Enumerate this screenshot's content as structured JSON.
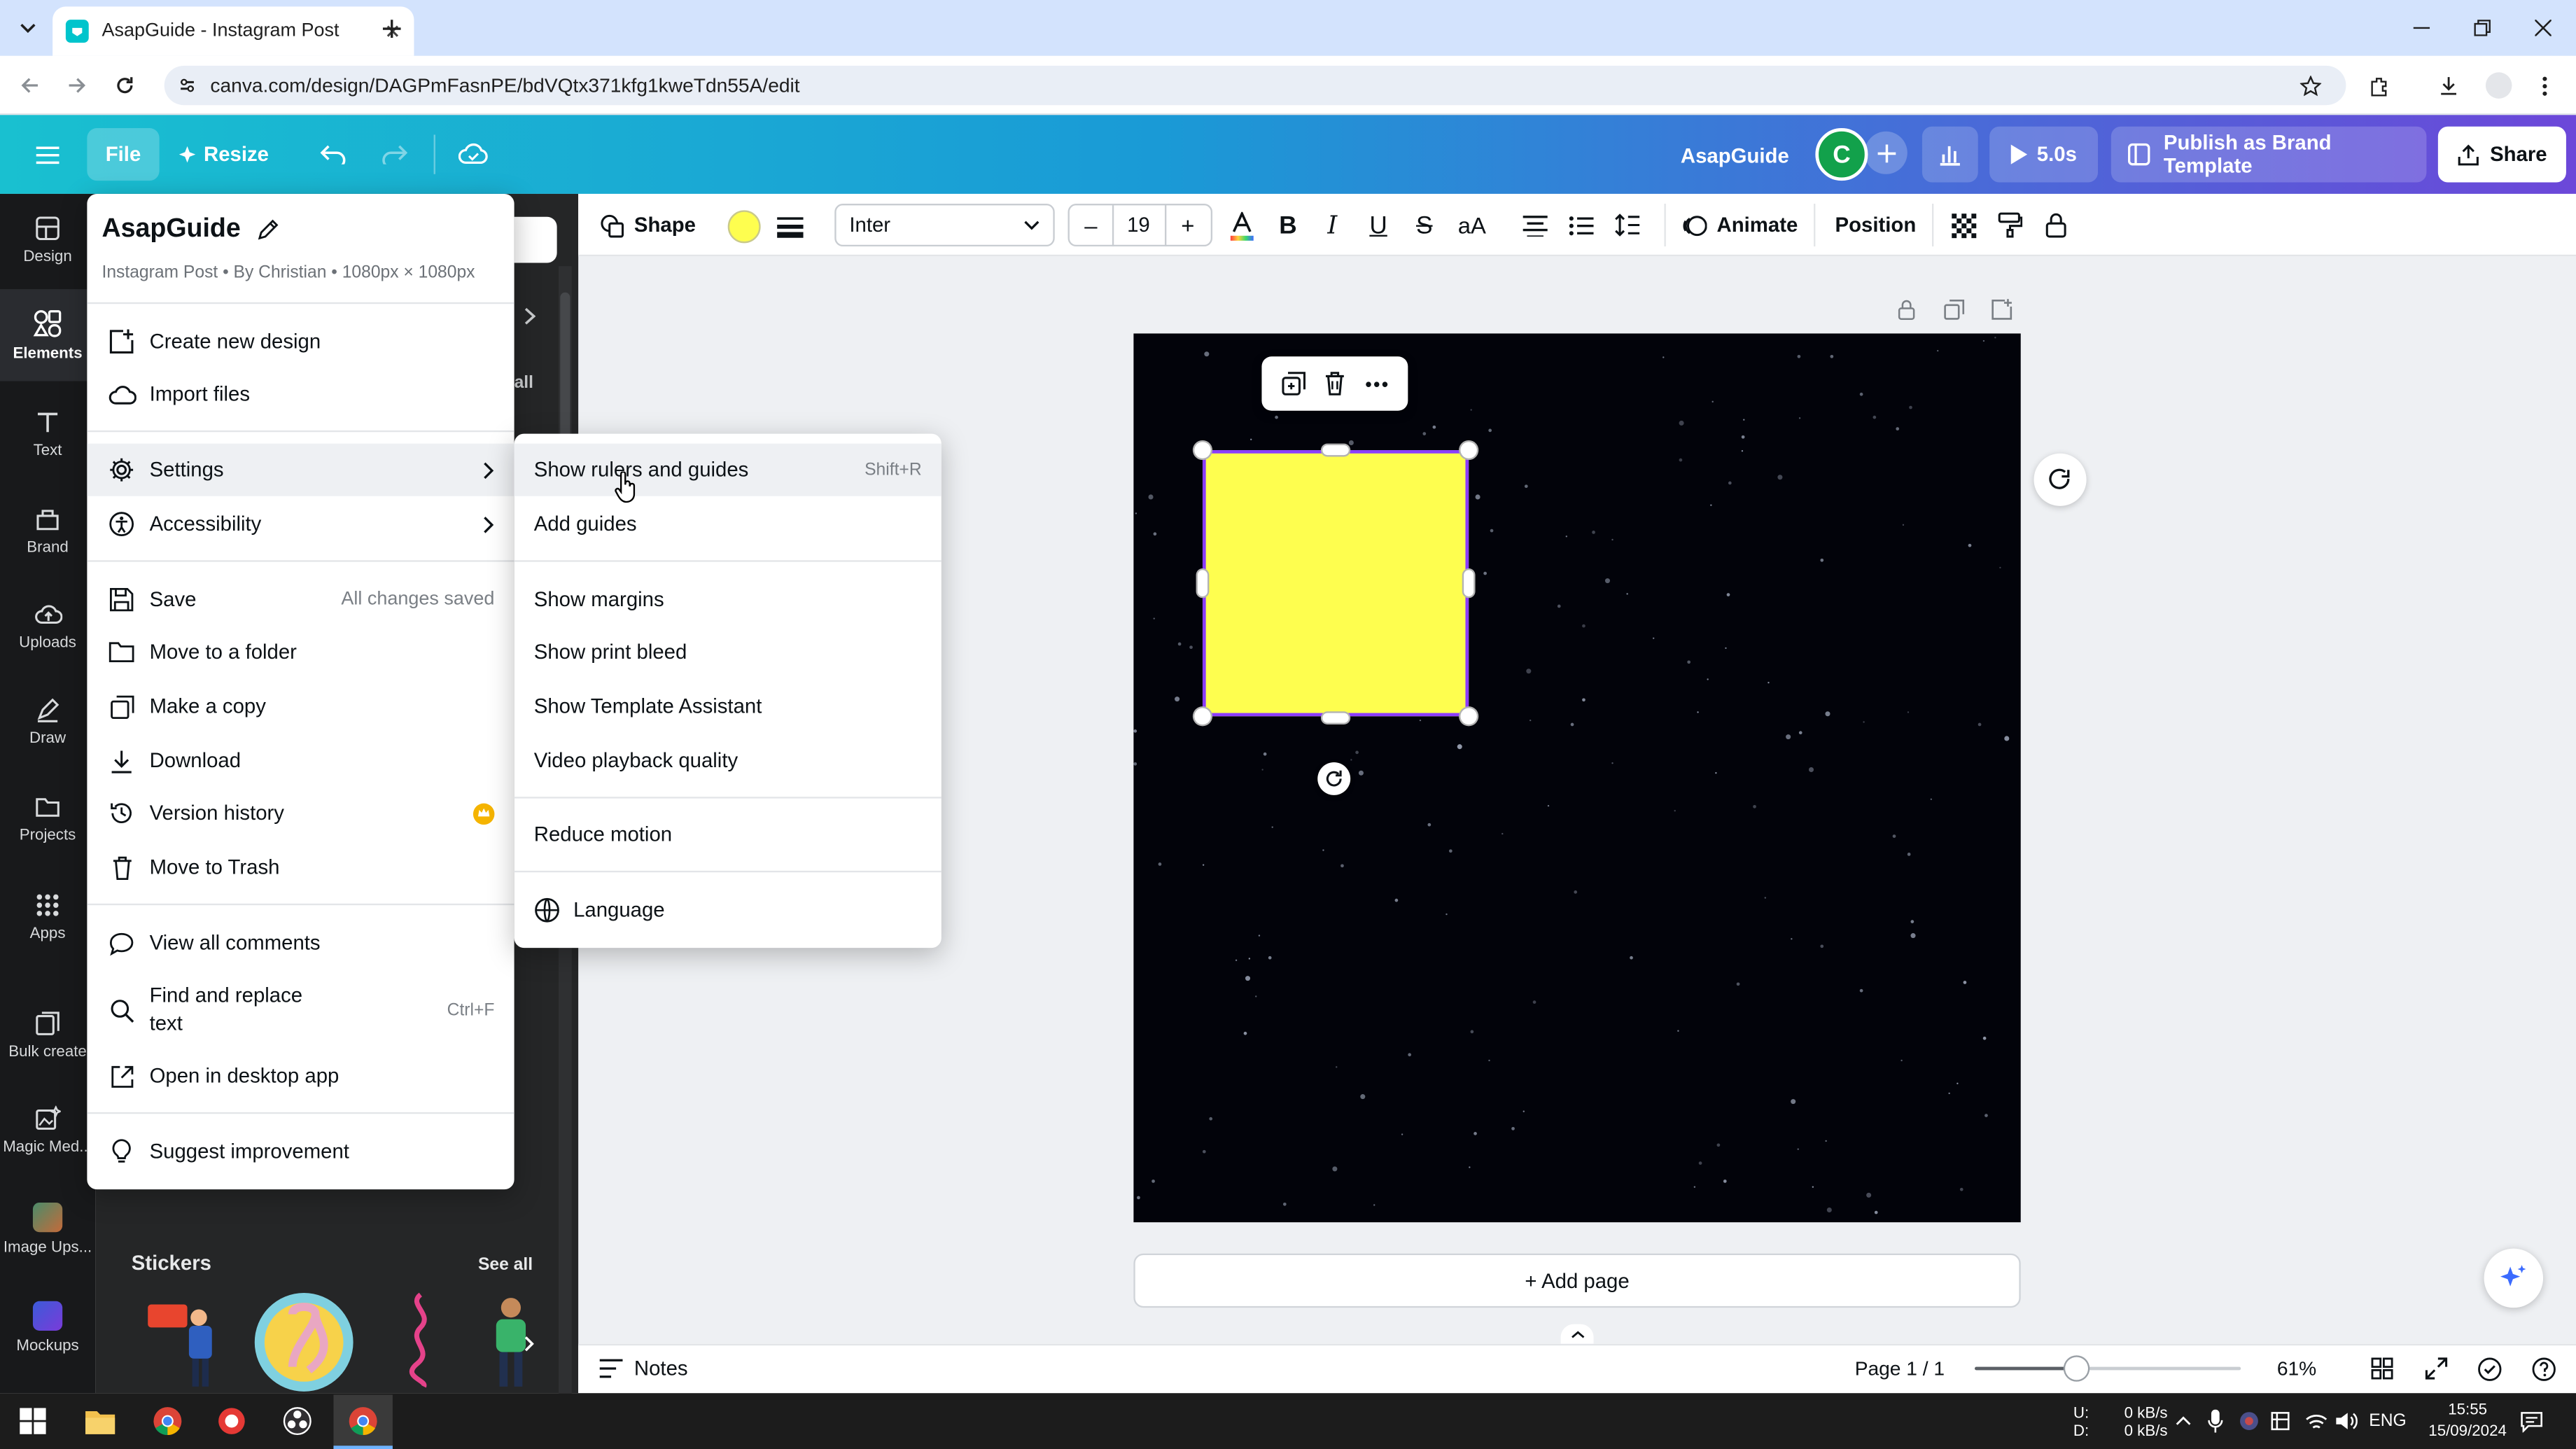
{
  "browser": {
    "tab_title": "AsapGuide - Instagram Post",
    "url": "canva.com/design/DAGPmFasnPE/bdVQtx371kfg1kweTdn55A/edit"
  },
  "header": {
    "file": "File",
    "resize": "Resize",
    "project_name": "AsapGuide",
    "avatar_letter": "C",
    "play_duration": "5.0s",
    "publish": "Publish as Brand Template",
    "share": "Share"
  },
  "rail": {
    "items": [
      {
        "label": "Design"
      },
      {
        "label": "Elements"
      },
      {
        "label": "Text"
      },
      {
        "label": "Brand"
      },
      {
        "label": "Uploads"
      },
      {
        "label": "Draw"
      },
      {
        "label": "Projects"
      },
      {
        "label": "Apps"
      },
      {
        "label": "Bulk create"
      },
      {
        "label": "Magic Med..."
      },
      {
        "label": "Image Ups..."
      },
      {
        "label": "Mockups"
      }
    ]
  },
  "panel": {
    "stickers_title": "Stickers",
    "see_all": "See all",
    "all_partial": "all"
  },
  "toolbar": {
    "shape": "Shape",
    "font": "Inter",
    "font_size": "19",
    "animate": "Animate",
    "position": "Position",
    "minus": "–",
    "plus": "+"
  },
  "canvas": {
    "add_page": "+ Add page"
  },
  "bottom": {
    "notes": "Notes",
    "page": "Page 1 / 1",
    "zoom": "61%",
    "zoom_level": 0.61
  },
  "file_menu": {
    "title": "AsapGuide",
    "subtitle": "Instagram Post • By Christian • 1080px × 1080px",
    "create_new": "Create new design",
    "import_files": "Import files",
    "settings": "Settings",
    "accessibility": "Accessibility",
    "save": "Save",
    "save_status": "All changes saved",
    "move_folder": "Move to a folder",
    "make_copy": "Make a copy",
    "download": "Download",
    "version_history": "Version history",
    "move_trash": "Move to Trash",
    "view_comments": "View all comments",
    "find_replace_1": "Find and replace",
    "find_replace_2": "text",
    "find_shortcut": "Ctrl+F",
    "open_desktop": "Open in desktop app",
    "suggest": "Suggest improvement"
  },
  "settings_menu": {
    "rulers": "Show rulers and guides",
    "rulers_shortcut": "Shift+R",
    "add_guides": "Add guides",
    "margins": "Show margins",
    "print_bleed": "Show print bleed",
    "template_assistant": "Show Template Assistant",
    "video_quality": "Video playback quality",
    "reduce_motion": "Reduce motion",
    "language": "Language"
  },
  "taskbar": {
    "net_up_label": "U:",
    "net_down_label": "D:",
    "net_up": "0 kB/s",
    "net_down": "0 kB/s",
    "lang": "ENG",
    "time": "15:55",
    "date": "15/09/2024"
  },
  "colors": {
    "accent": "#8b3dff",
    "shape_fill": "#fefe4f",
    "canvas_bg": "#02030a"
  }
}
